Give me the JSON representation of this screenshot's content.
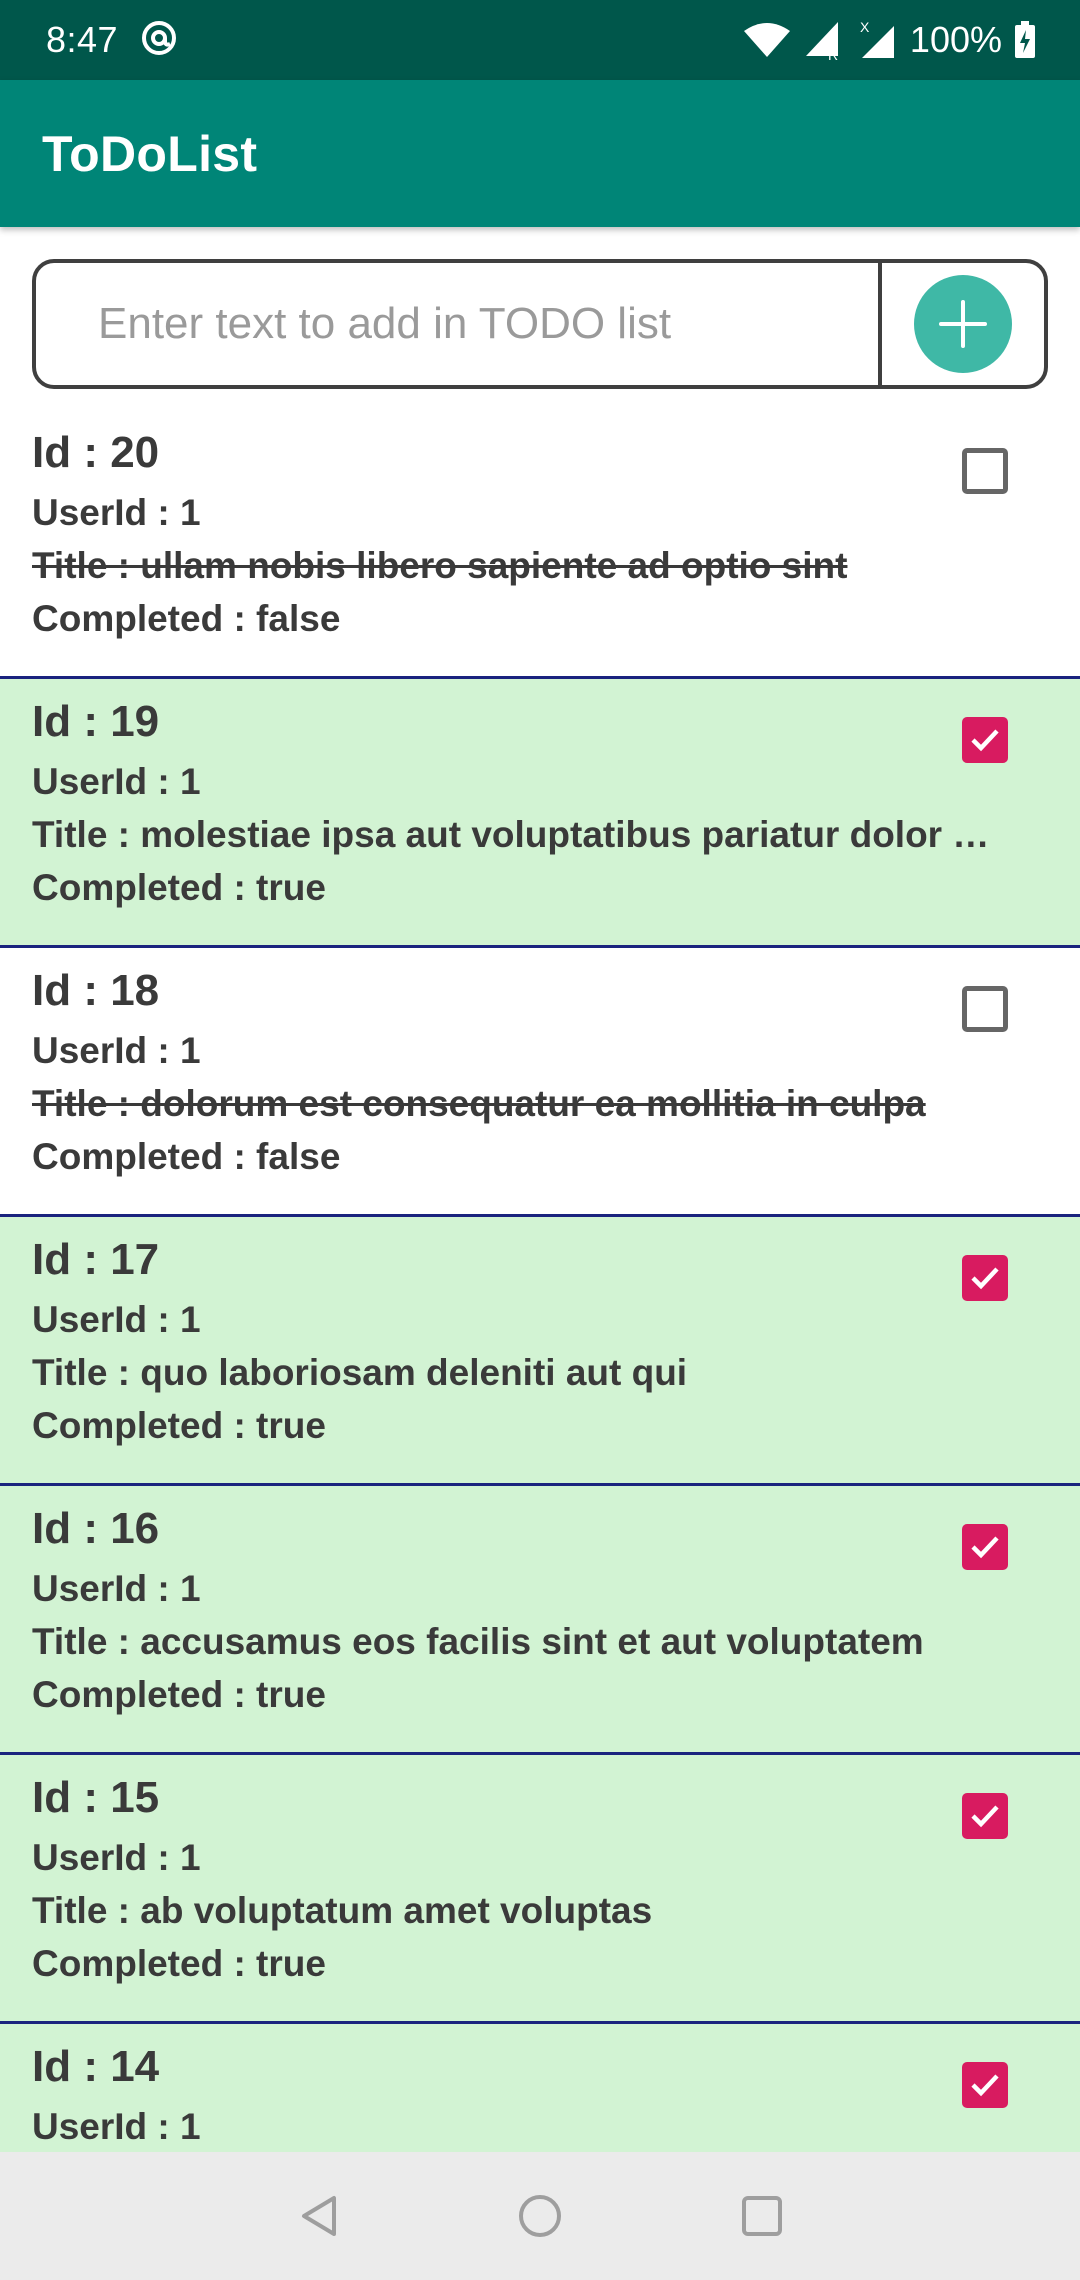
{
  "status_bar": {
    "time": "8:47",
    "battery": "100%",
    "icons": [
      "at-sign-icon",
      "wifi-icon",
      "signal-r-icon",
      "signal-x-icon",
      "battery-charging-icon"
    ]
  },
  "app_bar": {
    "title": "ToDoList"
  },
  "input": {
    "placeholder": "Enter text to add in TODO list",
    "value": ""
  },
  "add_button": {
    "icon": "plus-icon",
    "color": "#3fb8a6"
  },
  "colors": {
    "status_bar": "#00574b",
    "app_bar": "#008577",
    "completed_bg": "#d2f3d3",
    "checkbox_checked": "#d81b60",
    "divider": "#1a237e"
  },
  "todos": [
    {
      "id": "Id : 20",
      "user": "UserId : 1",
      "title": "Title : ullam nobis libero sapiente ad optio sint",
      "completed": "Completed : false",
      "checked": false
    },
    {
      "id": "Id : 19",
      "user": "UserId : 1",
      "title": "Title : molestiae ipsa aut voluptatibus pariatur dolor …",
      "completed": "Completed : true",
      "checked": true
    },
    {
      "id": "Id : 18",
      "user": "UserId : 1",
      "title": "Title : dolorum est consequatur ea mollitia in culpa",
      "completed": "Completed : false",
      "checked": false
    },
    {
      "id": "Id : 17",
      "user": "UserId : 1",
      "title": "Title : quo laboriosam deleniti aut qui",
      "completed": "Completed : true",
      "checked": true
    },
    {
      "id": "Id : 16",
      "user": "UserId : 1",
      "title": "Title : accusamus eos facilis sint et aut voluptatem",
      "completed": "Completed : true",
      "checked": true
    },
    {
      "id": "Id : 15",
      "user": "UserId : 1",
      "title": "Title : ab voluptatum amet voluptas",
      "completed": "Completed : true",
      "checked": true
    },
    {
      "id": "Id : 14",
      "user": "UserId : 1",
      "title": "",
      "completed": "",
      "checked": true
    }
  ],
  "nav_bar": {
    "buttons": [
      "back-icon",
      "home-icon",
      "recents-icon"
    ]
  }
}
